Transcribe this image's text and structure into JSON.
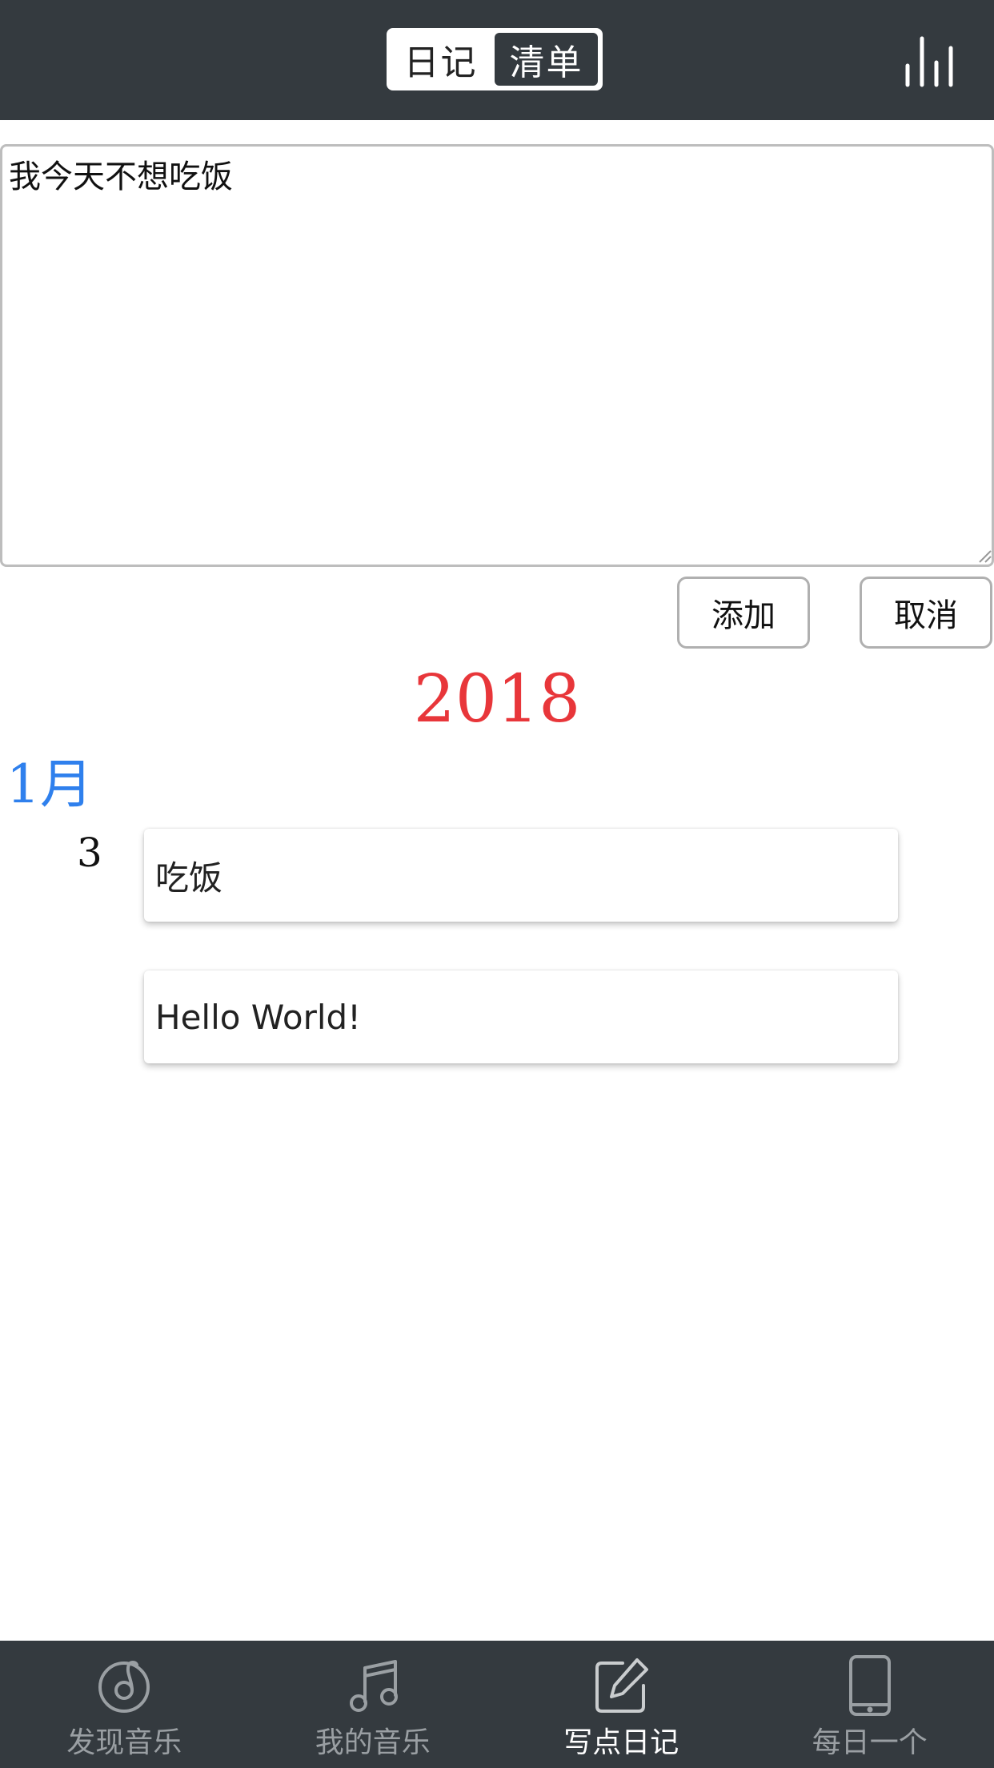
{
  "header": {
    "segments": [
      {
        "label": "日记",
        "active": false
      },
      {
        "label": "清单",
        "active": true
      }
    ],
    "right_icon": "bar-chart-icon"
  },
  "editor": {
    "value": "我今天不想吃饭"
  },
  "actions": {
    "add_label": "添加",
    "cancel_label": "取消"
  },
  "timeline": {
    "year": "2018",
    "month": "1月",
    "day": "3",
    "entries": [
      "吃饭",
      "Hello World!"
    ]
  },
  "tabbar": {
    "tabs": [
      {
        "label": "发现音乐",
        "icon": "discover-music-icon",
        "active": false
      },
      {
        "label": "我的音乐",
        "icon": "music-note-icon",
        "active": false
      },
      {
        "label": "写点日记",
        "icon": "edit-icon",
        "active": true
      },
      {
        "label": "每日一个",
        "icon": "phone-icon",
        "active": false
      }
    ]
  },
  "colors": {
    "bar_bg": "#343a3f",
    "year": "#e8363a",
    "month": "#2f80ed",
    "tab_inactive": "#9a9fa3",
    "tab_active": "#ffffff"
  }
}
